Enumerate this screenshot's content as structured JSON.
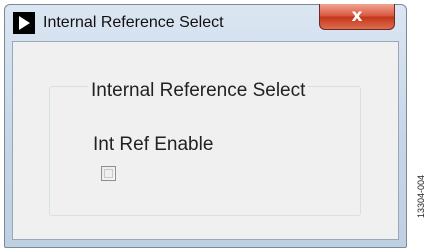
{
  "window": {
    "title": "Internal Reference Select",
    "close_glyph": "x",
    "icon": "play-arrow-icon"
  },
  "group": {
    "title": "Internal Reference Select",
    "checkbox_label": "Int Ref Enable",
    "checkbox_checked": false
  },
  "figure_code": "13304-004",
  "colors": {
    "close_button": "#c3361c",
    "title_bar": "#c6d6e8",
    "client_background": "#f0f0f0"
  }
}
